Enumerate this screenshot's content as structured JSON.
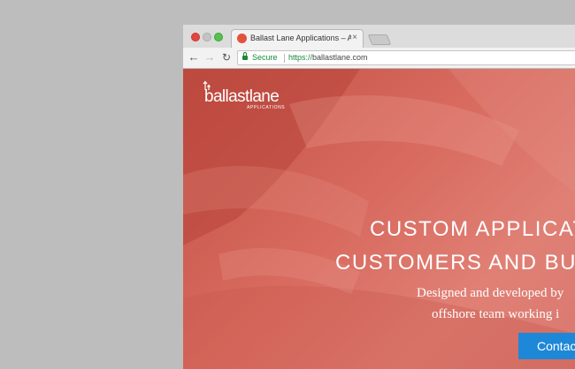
{
  "browser": {
    "tab": {
      "title": "Ballast Lane Applications – App",
      "close_glyph": "×",
      "favicon_icon": "ballastlane-favicon",
      "favicon_color": "#e0533d"
    },
    "nav": {
      "back_glyph": "←",
      "forward_glyph": "→",
      "reload_glyph": "↻"
    },
    "address": {
      "secure_label": "Secure",
      "scheme": "https://",
      "host": "ballastlane.com",
      "secure_color": "#178a3a"
    }
  },
  "page": {
    "logo": {
      "wordmark": "ballastlane",
      "tagline": "APPLICATIONS"
    },
    "headline": {
      "line1": "CUSTOM APPLICAT",
      "line2": "CUSTOMERS AND BUI"
    },
    "subheadline": {
      "line1": "Designed and developed by",
      "line2": "offshore team working i"
    },
    "cta": {
      "label": "Contac",
      "color": "#1e88d8"
    }
  },
  "colors": {
    "desktop_bg": "#bdbdbd",
    "hero_base": "#d06558"
  }
}
